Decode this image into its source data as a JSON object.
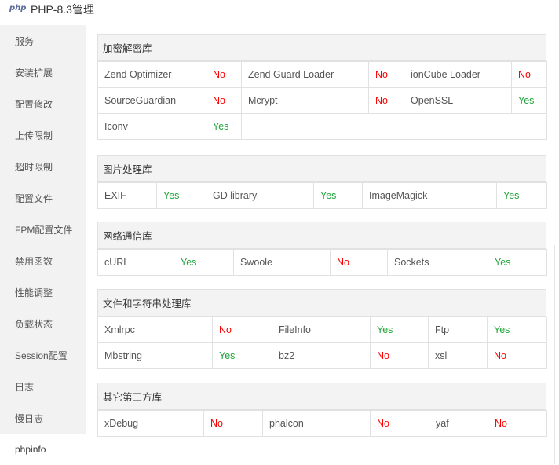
{
  "window": {
    "logo_text": "php",
    "title": "PHP-8.3管理"
  },
  "sidebar": {
    "items": [
      {
        "label": "服务"
      },
      {
        "label": "安装扩展"
      },
      {
        "label": "配置修改"
      },
      {
        "label": "上传限制"
      },
      {
        "label": "超时限制"
      },
      {
        "label": "配置文件"
      },
      {
        "label": "FPM配置文件"
      },
      {
        "label": "禁用函数"
      },
      {
        "label": "性能调整"
      },
      {
        "label": "负载状态"
      },
      {
        "label": "Session配置"
      },
      {
        "label": "日志"
      },
      {
        "label": "慢日志"
      },
      {
        "label": "phpinfo"
      }
    ],
    "active": "phpinfo"
  },
  "colors": {
    "yes": "#20a53a",
    "no": "#ff0000"
  },
  "sections": [
    {
      "title": "加密解密库",
      "rows": [
        [
          [
            "Zend Optimizer",
            "No"
          ],
          [
            "Zend Guard Loader",
            "No"
          ],
          [
            "ionCube Loader",
            "No"
          ]
        ],
        [
          [
            "SourceGuardian",
            "No"
          ],
          [
            "Mcrypt",
            "No"
          ],
          [
            "OpenSSL",
            "Yes"
          ]
        ],
        [
          [
            "Iconv",
            "Yes"
          ]
        ]
      ]
    },
    {
      "title": "图片处理库",
      "rows": [
        [
          [
            "EXIF",
            "Yes"
          ],
          [
            "GD library",
            "Yes"
          ],
          [
            "ImageMagick",
            "Yes"
          ]
        ]
      ]
    },
    {
      "title": "网络通信库",
      "rows": [
        [
          [
            "cURL",
            "Yes"
          ],
          [
            "Swoole",
            "No"
          ],
          [
            "Sockets",
            "Yes"
          ]
        ]
      ]
    },
    {
      "title": "文件和字符串处理库",
      "rows": [
        [
          [
            "Xmlrpc",
            "No"
          ],
          [
            "FileInfo",
            "Yes"
          ],
          [
            "Ftp",
            "Yes"
          ]
        ],
        [
          [
            "Mbstring",
            "Yes"
          ],
          [
            "bz2",
            "No"
          ],
          [
            "xsl",
            "No"
          ]
        ]
      ]
    },
    {
      "title": "其它第三方库",
      "rows": [
        [
          [
            "xDebug",
            "No"
          ],
          [
            "phalcon",
            "No"
          ],
          [
            "yaf",
            "No"
          ]
        ]
      ]
    }
  ]
}
